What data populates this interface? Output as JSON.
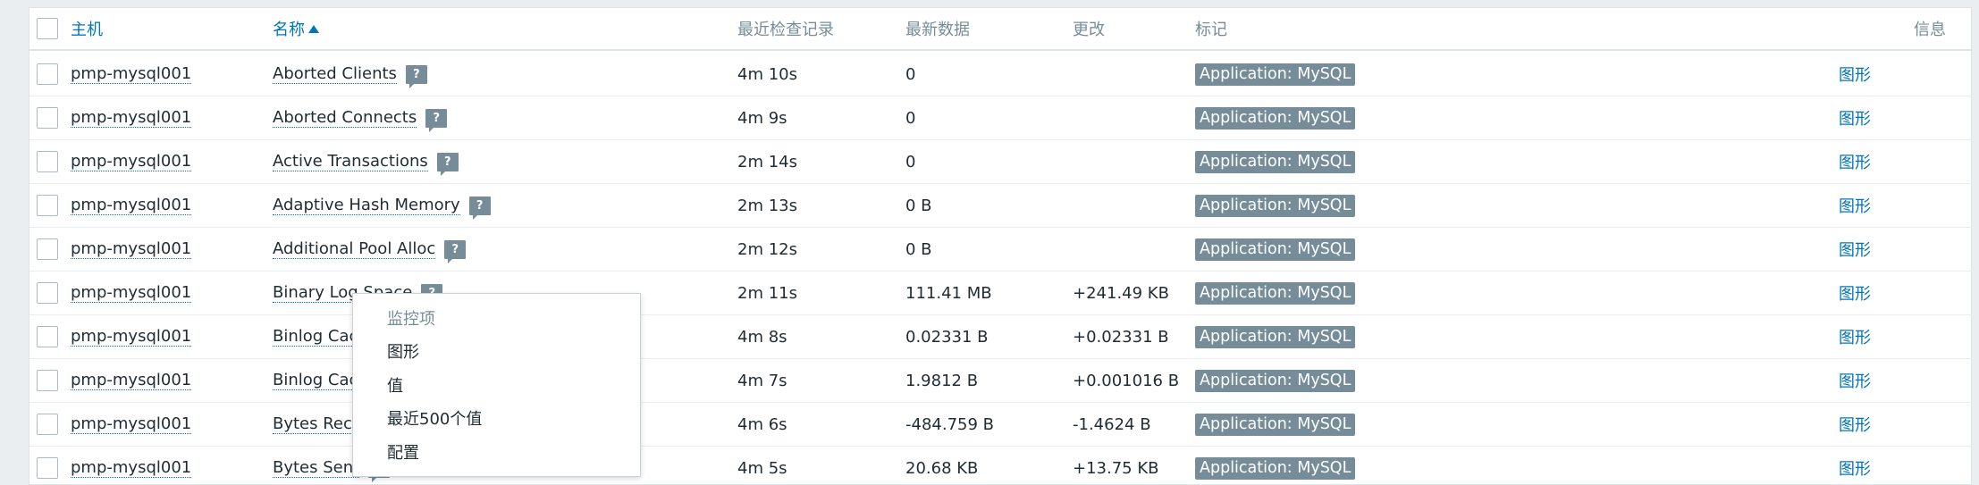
{
  "header": {
    "host": "主机",
    "name": "名称",
    "last_check": "最近检查记录",
    "last_value": "最新数据",
    "change": "更改",
    "tags": "标记",
    "info": "信息"
  },
  "rows": [
    {
      "host": "pmp-mysql001",
      "name": "Aborted Clients",
      "last_check": "4m 10s",
      "last_value": "0",
      "change": "",
      "tag": "Application: MySQL",
      "graph": "图形"
    },
    {
      "host": "pmp-mysql001",
      "name": "Aborted Connects",
      "last_check": "4m 9s",
      "last_value": "0",
      "change": "",
      "tag": "Application: MySQL",
      "graph": "图形"
    },
    {
      "host": "pmp-mysql001",
      "name": "Active Transactions",
      "last_check": "2m 14s",
      "last_value": "0",
      "change": "",
      "tag": "Application: MySQL",
      "graph": "图形"
    },
    {
      "host": "pmp-mysql001",
      "name": "Adaptive Hash Memory",
      "last_check": "2m 13s",
      "last_value": "0 B",
      "change": "",
      "tag": "Application: MySQL",
      "graph": "图形"
    },
    {
      "host": "pmp-mysql001",
      "name": "Additional Pool Alloc",
      "last_check": "2m 12s",
      "last_value": "0 B",
      "change": "",
      "tag": "Application: MySQL",
      "graph": "图形"
    },
    {
      "host": "pmp-mysql001",
      "name": "Binary Log Space",
      "last_check": "2m 11s",
      "last_value": "111.41 MB",
      "change": "+241.49 KB",
      "tag": "Application: MySQL",
      "graph": "图形"
    },
    {
      "host": "pmp-mysql001",
      "name": "Binlog Cac",
      "last_check": "4m 8s",
      "last_value": "0.02331 B",
      "change": "+0.02331 B",
      "tag": "Application: MySQL",
      "graph": "图形"
    },
    {
      "host": "pmp-mysql001",
      "name": "Binlog Cac",
      "last_check": "4m 7s",
      "last_value": "1.9812 B",
      "change": "+0.001016 B",
      "tag": "Application: MySQL",
      "graph": "图形"
    },
    {
      "host": "pmp-mysql001",
      "name": "Bytes Rece",
      "last_check": "4m 6s",
      "last_value": "-484.759 B",
      "change": "-1.4624 B",
      "tag": "Application: MySQL",
      "graph": "图形"
    },
    {
      "host": "pmp-mysql001",
      "name": "Bytes Sent",
      "last_check": "4m 5s",
      "last_value": "20.68 KB",
      "change": "+13.75 KB",
      "tag": "Application: MySQL",
      "graph": "图形"
    }
  ],
  "context_menu": {
    "heading": "监控项",
    "items": [
      "图形",
      "值",
      "最近500个值",
      "配置"
    ]
  },
  "icons": {
    "help": "help-icon",
    "sort": "sort-asc-icon"
  },
  "colors": {
    "link": "#0275b8",
    "tag_bg": "#768d99"
  }
}
